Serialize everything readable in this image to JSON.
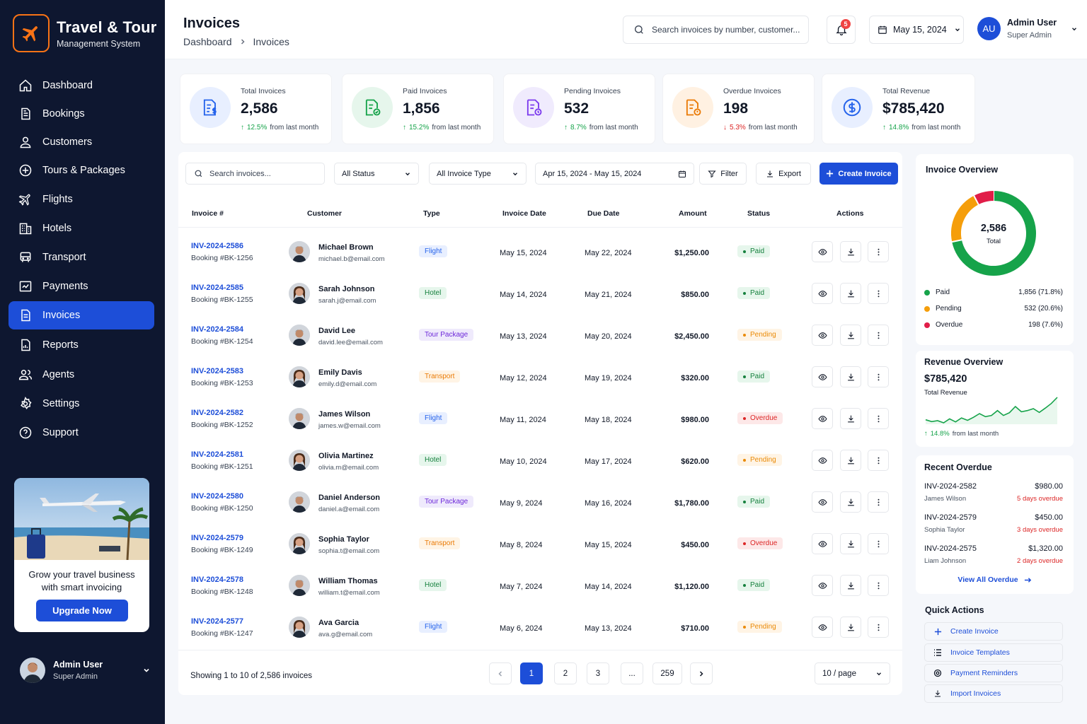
{
  "brand": {
    "title": "Travel & Tour",
    "subtitle": "Management System"
  },
  "nav": [
    {
      "label": "Dashboard",
      "icon": "home-icon"
    },
    {
      "label": "Bookings",
      "icon": "bookings-icon"
    },
    {
      "label": "Customers",
      "icon": "user-icon"
    },
    {
      "label": "Tours & Packages",
      "icon": "compass-icon"
    },
    {
      "label": "Flights",
      "icon": "plane-icon"
    },
    {
      "label": "Hotels",
      "icon": "building-icon"
    },
    {
      "label": "Transport",
      "icon": "bus-icon"
    },
    {
      "label": "Payments",
      "icon": "payments-icon"
    },
    {
      "label": "Invoices",
      "icon": "invoice-icon",
      "active": true
    },
    {
      "label": "Reports",
      "icon": "report-icon"
    },
    {
      "label": "Agents",
      "icon": "users-icon"
    },
    {
      "label": "Settings",
      "icon": "gear-icon"
    },
    {
      "label": "Support",
      "icon": "help-icon"
    }
  ],
  "promo": {
    "text_line1": "Grow your travel business",
    "text_line2": "with smart invoicing",
    "button": "Upgrade Now"
  },
  "sidebar_user": {
    "name": "Admin User",
    "role": "Super Admin"
  },
  "header": {
    "title": "Invoices",
    "breadcrumb": [
      "Dashboard",
      "Invoices"
    ],
    "search_placeholder": "Search invoices by number, customer...",
    "notifications": "5",
    "date": "May 15, 2024",
    "user": {
      "initials": "AU",
      "name": "Admin User",
      "role": "Super Admin"
    }
  },
  "stats": [
    {
      "label": "Total Invoices",
      "value": "2,586",
      "change": "12.5%",
      "direction": "up",
      "suffix": "from last month",
      "color": "#2563eb",
      "bg": "#e8efff",
      "icon": "invoice-dollar-icon"
    },
    {
      "label": "Paid Invoices",
      "value": "1,856",
      "change": "15.2%",
      "direction": "up",
      "suffix": "from last month",
      "color": "#16a34a",
      "bg": "#e6f6ec",
      "icon": "invoice-check-icon"
    },
    {
      "label": "Pending Invoices",
      "value": "532",
      "change": "8.7%",
      "direction": "up",
      "suffix": "from last month",
      "color": "#7c3aed",
      "bg": "#f0ebfd",
      "icon": "invoice-clock-icon"
    },
    {
      "label": "Overdue Invoices",
      "value": "198",
      "change": "5.3%",
      "direction": "down",
      "suffix": "from last month",
      "color": "#ea7a06",
      "bg": "#fff1e2",
      "icon": "invoice-alert-icon"
    },
    {
      "label": "Total Revenue",
      "value": "$785,420",
      "change": "14.8%",
      "direction": "up",
      "suffix": "from last month",
      "color": "#2563eb",
      "bg": "#e8efff",
      "icon": "dollar-circle-icon"
    }
  ],
  "toolbar": {
    "search_placeholder": "Search invoices...",
    "status_select": "All Status",
    "type_select": "All Invoice Type",
    "date_range": "Apr 15, 2024 - May 15, 2024",
    "filter": "Filter",
    "export": "Export",
    "create": "Create Invoice"
  },
  "table": {
    "columns": [
      "Invoice #",
      "Customer",
      "Type",
      "Invoice Date",
      "Due Date",
      "Amount",
      "Status",
      "Actions"
    ],
    "rows": [
      {
        "invoice": "INV-2024-2586",
        "booking": "Booking #BK-1256",
        "name": "Michael Brown",
        "email": "michael.b@email.com",
        "type": "Flight",
        "type_key": "flight",
        "invoice_date": "May 15, 2024",
        "due_date": "May 22, 2024",
        "amount": "$1,250.00",
        "status": "Paid",
        "status_key": "paid",
        "avatar": "m"
      },
      {
        "invoice": "INV-2024-2585",
        "booking": "Booking #BK-1255",
        "name": "Sarah Johnson",
        "email": "sarah.j@email.com",
        "type": "Hotel",
        "type_key": "hotel",
        "invoice_date": "May 14, 2024",
        "due_date": "May 21, 2024",
        "amount": "$850.00",
        "status": "Paid",
        "status_key": "paid",
        "avatar": "f"
      },
      {
        "invoice": "INV-2024-2584",
        "booking": "Booking #BK-1254",
        "name": "David Lee",
        "email": "david.lee@email.com",
        "type": "Tour Package",
        "type_key": "tour",
        "invoice_date": "May 13, 2024",
        "due_date": "May 20, 2024",
        "amount": "$2,450.00",
        "status": "Pending",
        "status_key": "pending",
        "avatar": "m"
      },
      {
        "invoice": "INV-2024-2583",
        "booking": "Booking #BK-1253",
        "name": "Emily Davis",
        "email": "emily.d@email.com",
        "type": "Transport",
        "type_key": "transport",
        "invoice_date": "May 12, 2024",
        "due_date": "May 19, 2024",
        "amount": "$320.00",
        "status": "Paid",
        "status_key": "paid",
        "avatar": "f"
      },
      {
        "invoice": "INV-2024-2582",
        "booking": "Booking #BK-1252",
        "name": "James Wilson",
        "email": "james.w@email.com",
        "type": "Flight",
        "type_key": "flight",
        "invoice_date": "May 11, 2024",
        "due_date": "May 18, 2024",
        "amount": "$980.00",
        "status": "Overdue",
        "status_key": "overdue",
        "avatar": "m"
      },
      {
        "invoice": "INV-2024-2581",
        "booking": "Booking #BK-1251",
        "name": "Olivia Martinez",
        "email": "olivia.m@email.com",
        "type": "Hotel",
        "type_key": "hotel",
        "invoice_date": "May 10, 2024",
        "due_date": "May 17, 2024",
        "amount": "$620.00",
        "status": "Pending",
        "status_key": "pending",
        "avatar": "f"
      },
      {
        "invoice": "INV-2024-2580",
        "booking": "Booking #BK-1250",
        "name": "Daniel Anderson",
        "email": "daniel.a@email.com",
        "type": "Tour Package",
        "type_key": "tour",
        "invoice_date": "May 9, 2024",
        "due_date": "May 16, 2024",
        "amount": "$1,780.00",
        "status": "Paid",
        "status_key": "paid",
        "avatar": "m"
      },
      {
        "invoice": "INV-2024-2579",
        "booking": "Booking #BK-1249",
        "name": "Sophia Taylor",
        "email": "sophia.t@email.com",
        "type": "Transport",
        "type_key": "transport",
        "invoice_date": "May 8, 2024",
        "due_date": "May 15, 2024",
        "amount": "$450.00",
        "status": "Overdue",
        "status_key": "overdue",
        "avatar": "f"
      },
      {
        "invoice": "INV-2024-2578",
        "booking": "Booking #BK-1248",
        "name": "William Thomas",
        "email": "william.t@email.com",
        "type": "Hotel",
        "type_key": "hotel",
        "invoice_date": "May 7, 2024",
        "due_date": "May 14, 2024",
        "amount": "$1,120.00",
        "status": "Paid",
        "status_key": "paid",
        "avatar": "m"
      },
      {
        "invoice": "INV-2024-2577",
        "booking": "Booking #BK-1247",
        "name": "Ava Garcia",
        "email": "ava.g@email.com",
        "type": "Flight",
        "type_key": "flight",
        "invoice_date": "May 6, 2024",
        "due_date": "May 13, 2024",
        "amount": "$710.00",
        "status": "Pending",
        "status_key": "pending",
        "avatar": "f"
      }
    ]
  },
  "pagination": {
    "showing": "Showing 1 to 10 of 2,586 invoices",
    "pages": [
      "1",
      "2",
      "3",
      "...",
      "259"
    ],
    "per_page": "10 / page"
  },
  "overview": {
    "title": "Invoice Overview",
    "center_value": "2,586",
    "center_label": "Total",
    "segments": [
      {
        "label": "Paid",
        "value": 1856,
        "display": "1,856 (71.8%)",
        "color": "#16a34a"
      },
      {
        "label": "Pending",
        "value": 532,
        "display": "532 (20.6%)",
        "color": "#f59e0b"
      },
      {
        "label": "Overdue",
        "value": 198,
        "display": "198 (7.6%)",
        "color": "#e11d48"
      }
    ]
  },
  "revenue": {
    "title": "Revenue Overview",
    "value": "$785,420",
    "label": "Total Revenue",
    "change": "14.8%",
    "suffix": "from last month",
    "line_color": "#16a34a",
    "trend": [
      22,
      16,
      19,
      12,
      25,
      15,
      28,
      20,
      30,
      42,
      32,
      36,
      52,
      36,
      45,
      65,
      48,
      52,
      58,
      46,
      60,
      75,
      95
    ]
  },
  "recent_overdue": {
    "title": "Recent Overdue",
    "items": [
      {
        "invoice": "INV-2024-2582",
        "amount": "$980.00",
        "name": "James Wilson",
        "overdue": "5 days overdue"
      },
      {
        "invoice": "INV-2024-2579",
        "amount": "$450.00",
        "name": "Sophia Taylor",
        "overdue": "3 days overdue"
      },
      {
        "invoice": "INV-2024-2575",
        "amount": "$1,320.00",
        "name": "Liam Johnson",
        "overdue": "2 days overdue"
      }
    ],
    "view_all": "View All Overdue"
  },
  "quick_actions": {
    "title": "Quick Actions",
    "items": [
      {
        "label": "Create Invoice",
        "icon": "plus-icon"
      },
      {
        "label": "Invoice Templates",
        "icon": "list-icon"
      },
      {
        "label": "Payment Reminders",
        "icon": "reminder-icon"
      },
      {
        "label": "Import Invoices",
        "icon": "import-icon"
      }
    ]
  }
}
